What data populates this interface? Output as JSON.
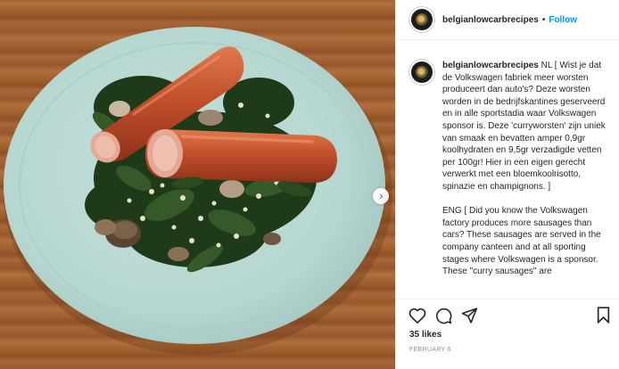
{
  "post": {
    "username": "belgianlowcarbrecipes",
    "separator": "•",
    "follow_label": "Follow",
    "caption_lang_nl": "NL [ Wist je dat de Volkswagen fabriek meer worsten produceert dan auto's? Deze worsten worden in de bedrijfskantines geserveerd en in alle sportstadia waar Volkswagen sponsor is. Deze 'curryworsten' zijn uniek van smaak en bevatten amper 0,9gr koolhydraten en 9,5gr verzadigde vetten per 100gr! Hier in een eigen gerecht verwerkt met een bloemkoolrisotto, spinazie en champignons. ]",
    "caption_lang_en": "ENG [ Did you know the Volkswagen factory produces more sausages than cars? These sausages are served in the company canteen and at all sporting stages where Volkswagen is a sponsor. These \"curry sausages\" are",
    "likes": "35 likes",
    "date": "FEBRUARY 6"
  },
  "icons": {
    "like": "heart-icon",
    "comment": "comment-icon",
    "share": "share-icon",
    "save": "bookmark-icon",
    "next": "chevron-right-icon"
  },
  "colors": {
    "link": "#0095f6",
    "text": "#262626",
    "muted": "#8e8e8e",
    "plate": "#b8d8d2",
    "sausage": "#c24f2c"
  }
}
